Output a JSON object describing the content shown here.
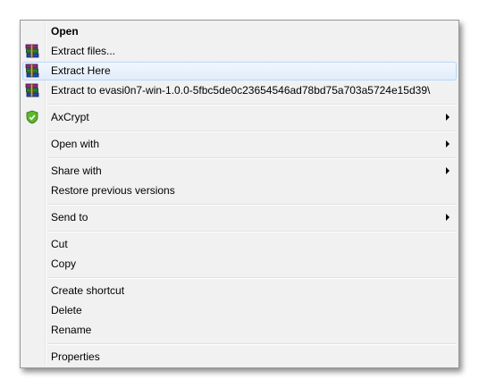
{
  "menu": {
    "open": "Open",
    "extract_files": "Extract files...",
    "extract_here": "Extract Here",
    "extract_to": "Extract to evasi0n7-win-1.0.0-5fbc5de0c23654546ad78bd75a703a5724e15d39\\",
    "axcrypt": "AxCrypt",
    "open_with": "Open with",
    "share_with": "Share with",
    "restore_previous_versions": "Restore previous versions",
    "send_to": "Send to",
    "cut": "Cut",
    "copy": "Copy",
    "create_shortcut": "Create shortcut",
    "delete": "Delete",
    "rename": "Rename",
    "properties": "Properties"
  },
  "icons": {
    "winrar": "winrar-books-icon",
    "axcrypt": "axcrypt-shield-icon",
    "submenu": "chevron-right-icon"
  },
  "colors": {
    "menu_background": "#f1f1f1",
    "menu_border": "#979797",
    "hover_border": "#b8d6fb",
    "axcrypt_shield": "#5cb82a"
  }
}
